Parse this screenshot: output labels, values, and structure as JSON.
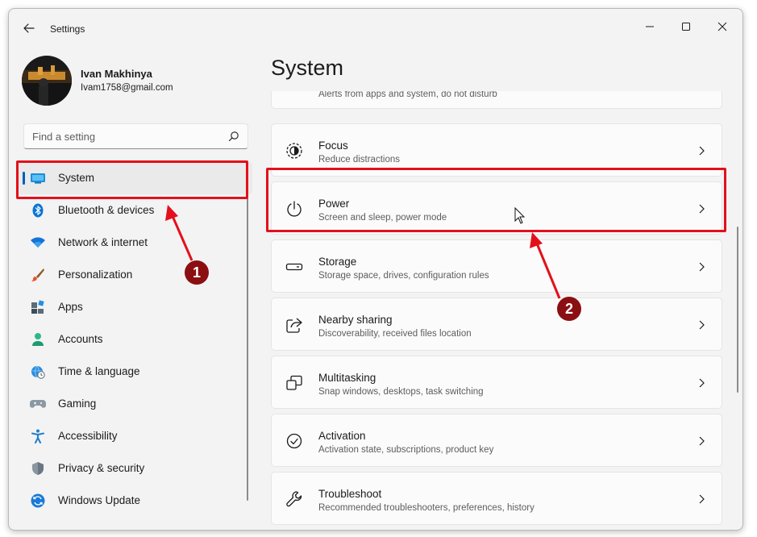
{
  "window": {
    "title": "Settings",
    "controls": [
      "minimize",
      "maximize",
      "close"
    ]
  },
  "profile": {
    "name": "Ivan Makhinya",
    "email": "Ivam1758@gmail.com"
  },
  "search": {
    "placeholder": "Find a setting",
    "value": ""
  },
  "sidebar": {
    "selected": "System",
    "items": [
      {
        "label": "System",
        "icon": "system-icon"
      },
      {
        "label": "Bluetooth & devices",
        "icon": "bluetooth-icon"
      },
      {
        "label": "Network & internet",
        "icon": "wifi-icon"
      },
      {
        "label": "Personalization",
        "icon": "paintbrush-icon"
      },
      {
        "label": "Apps",
        "icon": "apps-icon"
      },
      {
        "label": "Accounts",
        "icon": "person-icon"
      },
      {
        "label": "Time & language",
        "icon": "globe-clock-icon"
      },
      {
        "label": "Gaming",
        "icon": "gamepad-icon"
      },
      {
        "label": "Accessibility",
        "icon": "accessibility-icon"
      },
      {
        "label": "Privacy & security",
        "icon": "shield-icon"
      },
      {
        "label": "Windows Update",
        "icon": "update-icon"
      }
    ]
  },
  "main": {
    "title": "System",
    "partial_card_desc": "Alerts from apps and system, do not disturb",
    "cards": [
      {
        "title": "Focus",
        "desc": "Reduce distractions",
        "icon": "focus-icon"
      },
      {
        "title": "Power",
        "desc": "Screen and sleep, power mode",
        "icon": "power-icon"
      },
      {
        "title": "Storage",
        "desc": "Storage space, drives, configuration rules",
        "icon": "storage-icon"
      },
      {
        "title": "Nearby sharing",
        "desc": "Discoverability, received files location",
        "icon": "share-icon"
      },
      {
        "title": "Multitasking",
        "desc": "Snap windows, desktops, task switching",
        "icon": "multitasking-icon"
      },
      {
        "title": "Activation",
        "desc": "Activation state, subscriptions, product key",
        "icon": "check-circle-icon"
      },
      {
        "title": "Troubleshoot",
        "desc": "Recommended troubleshooters, preferences, history",
        "icon": "wrench-icon"
      }
    ]
  },
  "annotations": {
    "step1": "1",
    "step2": "2",
    "color": "#e3101b",
    "badge_color": "#8b0f12"
  },
  "colors": {
    "accent": "#005fb8",
    "window_bg": "#f3f3f3",
    "card_bg": "#fbfbfb"
  }
}
